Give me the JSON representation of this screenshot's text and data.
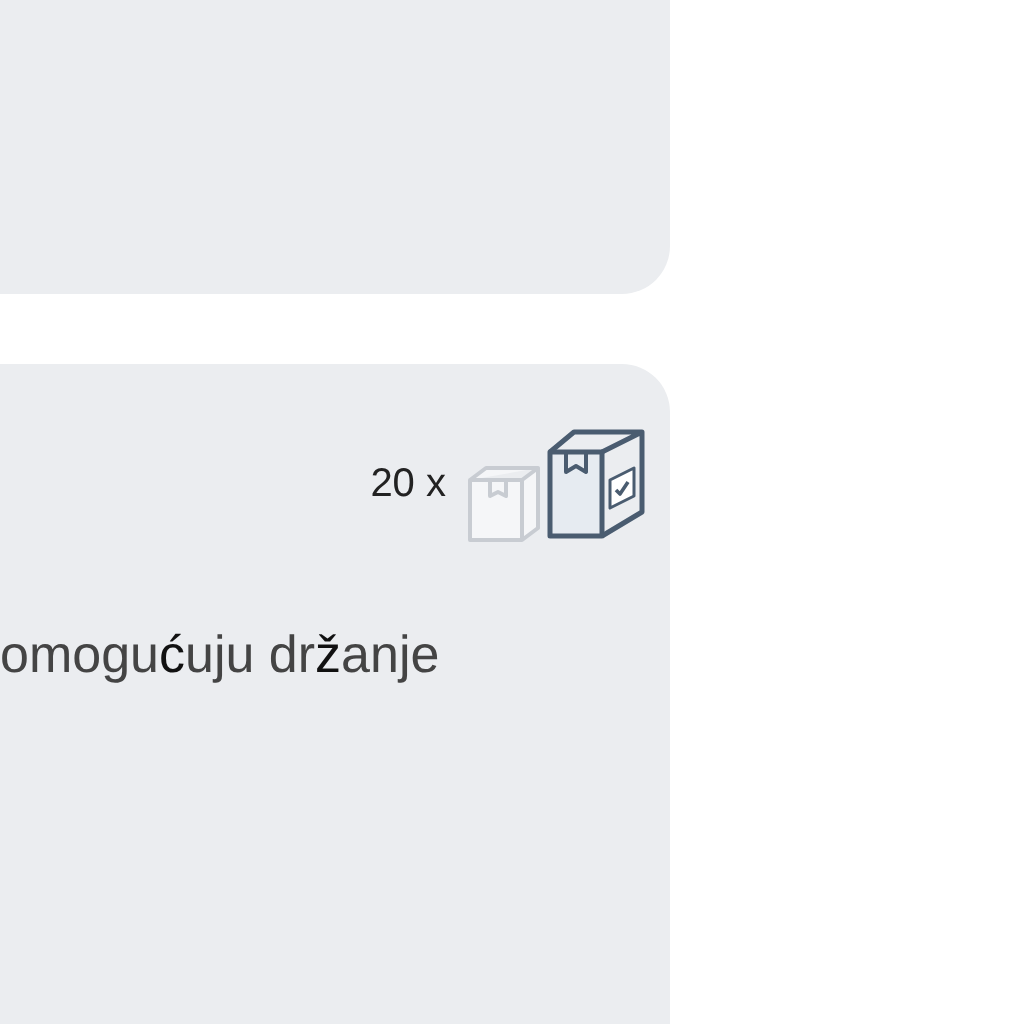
{
  "cards": [
    {
      "kind": "empty"
    },
    {
      "kind": "content",
      "quantity": "20 x",
      "text": "omogu**ć**uju dr**ž**anje"
    }
  ]
}
